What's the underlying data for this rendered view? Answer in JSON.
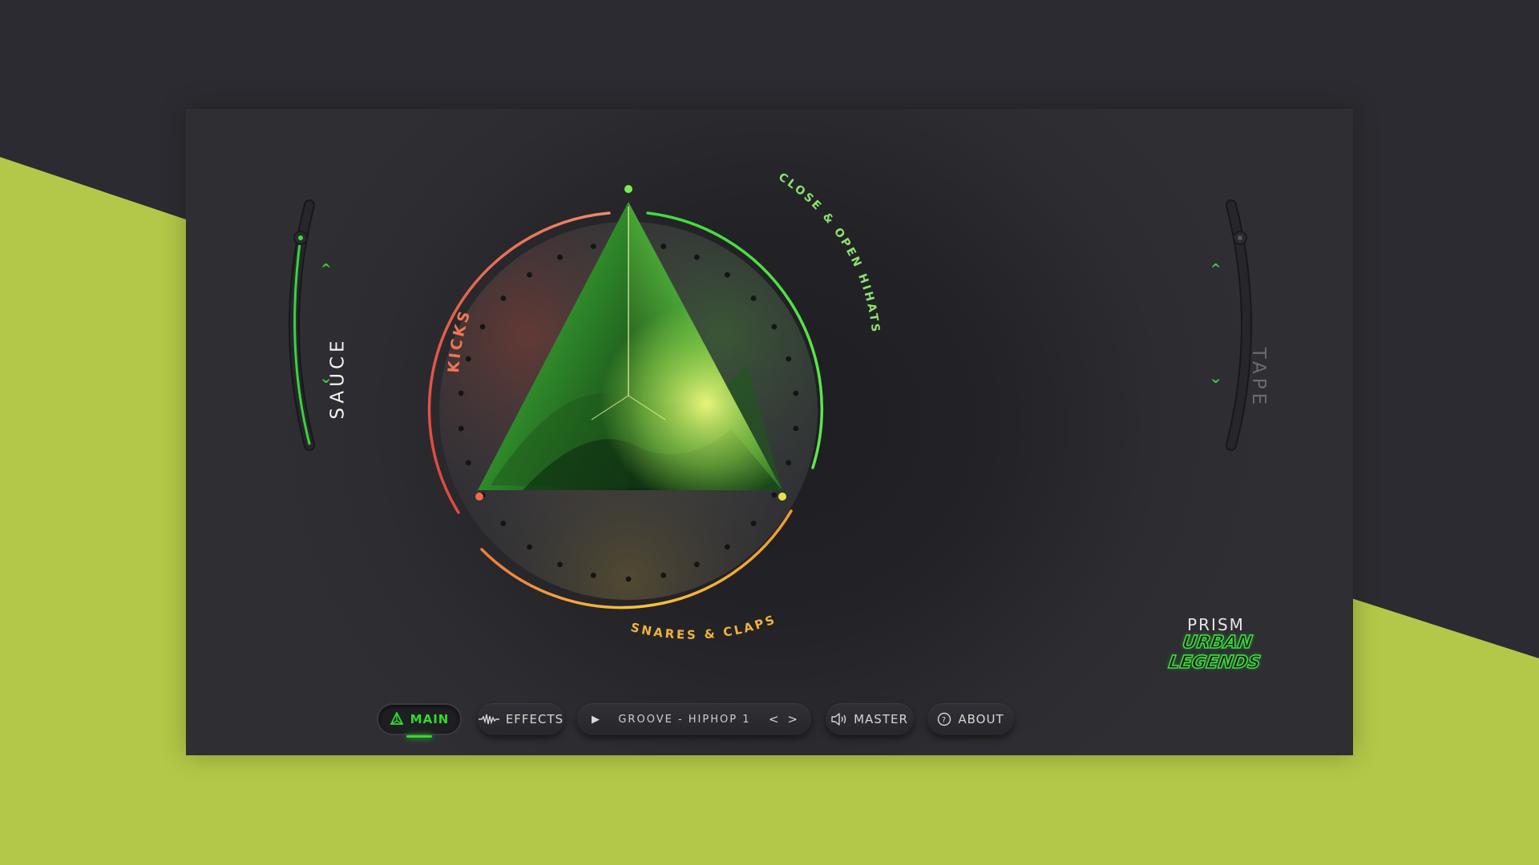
{
  "app": {
    "brand": "PRISM",
    "brand_subtitle": "URBAN LEGENDS"
  },
  "colors": {
    "background": "#2b2b31",
    "accent_green": "#b3c848",
    "panel": "#2a2a2f",
    "kicks": "#e4664a",
    "hihats": "#58e24a",
    "snares": "#f0b23a"
  },
  "knob": {
    "labels": {
      "kicks": "KICKS",
      "hihats": "CLOSE & OPEN HIHATS",
      "snares": "SNARES & CLAPS"
    }
  },
  "sliders": {
    "left": {
      "label": "SAUCE",
      "level": 0.8,
      "up_icon": "chevron-up-icon",
      "down_icon": "chevron-down-icon"
    },
    "right": {
      "label": "TAPE",
      "level": 0.0,
      "up_icon": "chevron-up-icon",
      "down_icon": "chevron-down-icon"
    }
  },
  "toolbar": {
    "main_label": "MAIN",
    "main_icon": "prism-icon",
    "effects_label": "EFFECTS",
    "effects_icon": "waveform-icon",
    "preset": {
      "name": "GROOVE - HIPHOP 1",
      "play_icon": "play-icon",
      "prev": "<",
      "next": ">"
    },
    "master_label": "MASTER",
    "master_icon": "speaker-icon",
    "about_label": "ABOUT",
    "about_icon": "help-icon"
  }
}
